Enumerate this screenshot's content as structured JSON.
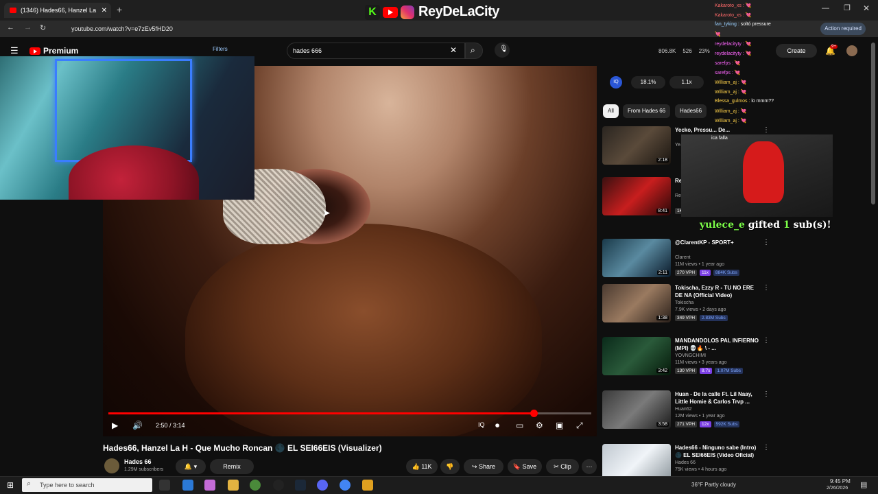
{
  "browser": {
    "tab_title": "(1346) Hades66, Hanzel La",
    "url": "youtube.com/watch?v=e7zEv5fHD20",
    "action_required": "Action required"
  },
  "header": {
    "logo_text": "Premium",
    "search_value": "hades 666",
    "filters_label": "Filters",
    "stats": [
      "806.8K",
      "526",
      "23%"
    ],
    "create_label": "Create",
    "notif_badge": "9+"
  },
  "banner": {
    "k_letter": "K",
    "name": "ReyDeLaCity"
  },
  "player": {
    "time": "2:50 / 3:14",
    "progress": 0.88
  },
  "video": {
    "title": "Hades66, Hanzel La H - Que Mucho Roncan 🌑 EL SEI66EIS (Visualizer)",
    "channel": "Hades 66",
    "subscribers": "1.29M subscribers",
    "remix_label": "Remix",
    "likes": "11K",
    "share_label": "Share",
    "save_label": "Save",
    "clip_label": "Clip"
  },
  "iq_bar": {
    "badge": "IQ",
    "chips": [
      "18.1%",
      "1.1x"
    ]
  },
  "filter_chips": [
    "All",
    "From Hades 66",
    "Hades66"
  ],
  "recommendations": [
    {
      "title": "Yecko, Pressu... De...",
      "channel": "Ye...",
      "stats": "",
      "duration": "2:18",
      "vph": "",
      "mult": "",
      "subs": ""
    },
    {
      "title": "Re... LU...",
      "channel": "Re... 1.1...",
      "stats": "",
      "duration": "8:41",
      "vph": "1K VPH",
      "mult": "",
      "subs": ""
    },
    {
      "title": "@ClarentKP - SPORT+",
      "channel": "Clarent",
      "stats": "11M views • 1 year ago",
      "duration": "2:11",
      "vph": "270 VPH",
      "mult": "11x",
      "subs": "884K Subs"
    },
    {
      "title": "Tokischa, Ezzy R - TU NO ERE DE NA (Official Video)",
      "channel": "Tokischa",
      "stats": "7.9K views • 2 days ago",
      "duration": "1:38",
      "vph": "349 VPH",
      "mult": "",
      "subs": "2.83M Subs"
    },
    {
      "title": "MANDANDOLOS PAL INFIERNO (MPI) 💀🔥 \\ - ...",
      "channel": "YOVNGCHIMI",
      "stats": "11M views • 3 years ago",
      "duration": "3:42",
      "vph": "130 VPH",
      "mult": "8.7x",
      "subs": "1.07M Subs"
    },
    {
      "title": "Huan - De la calle Ft. Lil Naay, Little Homie & Carlos Trvp ...",
      "channel": "Huan62",
      "stats": "12M views • 1 year ago",
      "duration": "3:58",
      "vph": "271 VPH",
      "mult": "12x",
      "subs": "592K Subs"
    },
    {
      "title": "Hades66 - Ninguno sabe (Intro) 🌑 EL SEI66EIS (Video Oficial)",
      "channel": "Hades 66",
      "stats": "75K views • 4 hours ago",
      "duration": "",
      "vph": "",
      "mult": "",
      "subs": ""
    }
  ],
  "chat": [
    {
      "user": "Kakaroto_xs",
      "msg": "💘",
      "cls": "u1"
    },
    {
      "user": "Kakaroto_xs",
      "msg": "💘",
      "cls": "u1"
    },
    {
      "user": "fan_tyking",
      "msg": "soltó pressure",
      "cls": "u4"
    },
    {
      "user": "",
      "msg": "💘",
      "cls": "u3"
    },
    {
      "user": "reydelacityty",
      "msg": "💘",
      "cls": "u3"
    },
    {
      "user": "reydelacityty",
      "msg": "💘",
      "cls": "u3"
    },
    {
      "user": "sarefps",
      "msg": "💘",
      "cls": "u3"
    },
    {
      "user": "sarefps",
      "msg": "💘",
      "cls": "u3"
    },
    {
      "user": "William_aj",
      "msg": "💘",
      "cls": "u2"
    },
    {
      "user": "William_aj",
      "msg": "💘",
      "cls": "u2"
    },
    {
      "user": "Blessa_gulmos",
      "msg": "lo mmm??",
      "cls": "u2"
    },
    {
      "user": "William_aj",
      "msg": "💘",
      "cls": "u2"
    },
    {
      "user": "William_aj",
      "msg": "💘",
      "cls": "u2"
    }
  ],
  "chat_extra": "ica falla",
  "gift": {
    "user": "yulece_e",
    "text": "gifted",
    "count": "1",
    "suffix": "sub(s)!"
  },
  "taskbar": {
    "search_placeholder": "Type here to search",
    "weather": "36°F  Partly cloudy",
    "time": "9:45 PM",
    "date": "2/26/2026"
  }
}
